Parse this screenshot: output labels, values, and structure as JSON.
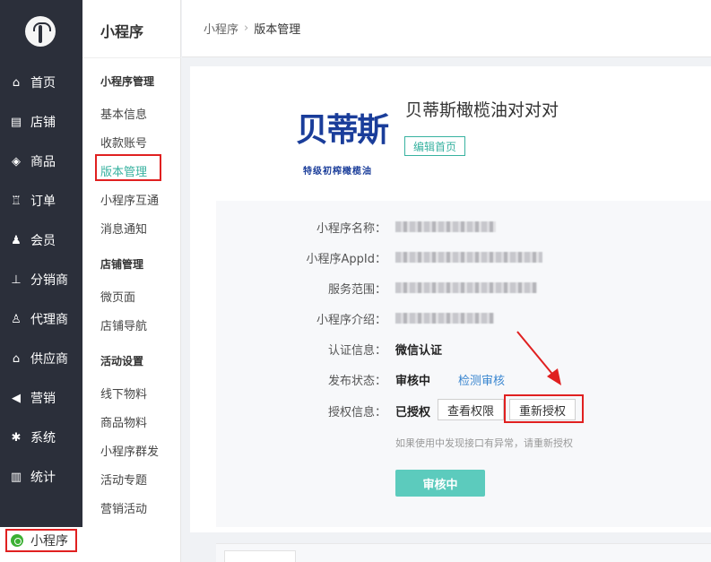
{
  "nav": {
    "items": [
      {
        "label": "首页",
        "icon": "home-icon",
        "glyph": "⌂"
      },
      {
        "label": "店铺",
        "icon": "store-icon",
        "glyph": "▤"
      },
      {
        "label": "商品",
        "icon": "box-icon",
        "glyph": "◈"
      },
      {
        "label": "订单",
        "icon": "cart-icon",
        "glyph": "♖"
      },
      {
        "label": "会员",
        "icon": "user-icon",
        "glyph": "♟"
      },
      {
        "label": "分销商",
        "icon": "sitemap-icon",
        "glyph": "⊥"
      },
      {
        "label": "代理商",
        "icon": "agent-icon",
        "glyph": "♙"
      },
      {
        "label": "供应商",
        "icon": "bank-icon",
        "glyph": "⌂"
      },
      {
        "label": "营销",
        "icon": "megaphone-icon",
        "glyph": "◀"
      },
      {
        "label": "系统",
        "icon": "gear-icon",
        "glyph": "✱"
      },
      {
        "label": "统计",
        "icon": "bar-chart-icon",
        "glyph": "▥"
      }
    ],
    "bottom_item": "小程序"
  },
  "subnav": {
    "title": "小程序",
    "groups": [
      {
        "heading": "小程序管理",
        "items": [
          "基本信息",
          "收款账号",
          "版本管理",
          "小程序互通",
          "消息通知"
        ]
      },
      {
        "heading": "店铺管理",
        "items": [
          "微页面",
          "店铺导航"
        ]
      },
      {
        "heading": "活动设置",
        "items": [
          "线下物料",
          "商品物料",
          "小程序群发",
          "活动专题",
          "营销活动"
        ]
      }
    ]
  },
  "breadcrumb": {
    "root": "小程序",
    "current": "版本管理"
  },
  "app": {
    "logo_text": "贝蒂斯",
    "logo_sub": "特级初榨橄榄油",
    "name": "贝蒂斯橄榄油对对对",
    "edit_label": "编辑首页"
  },
  "info": {
    "name_label": "小程序名称：",
    "appid_label": "小程序AppId：",
    "scope_label": "服务范围：",
    "intro_label": "小程序介绍：",
    "cert_label": "认证信息：",
    "cert_value": "微信认证",
    "publish_label": "发布状态：",
    "publish_value": "审核中",
    "publish_link": "检测审核",
    "auth_label": "授权信息：",
    "auth_value": "已授权",
    "view_perm": "查看权限",
    "reauth": "重新授权",
    "hint": "如果使用中发现接口有异常，请重新授权",
    "status_button": "审核中"
  },
  "colors": {
    "accent": "#38b2a0",
    "nav_bg": "#2b2f3a",
    "highlight": "#e02020",
    "link": "#3a86d0",
    "status_btn": "#5ccbbd"
  }
}
